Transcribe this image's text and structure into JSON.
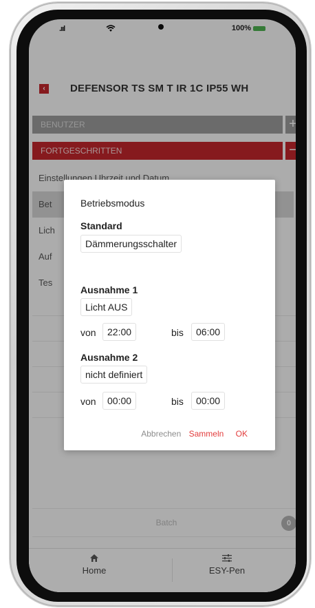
{
  "status_bar": {
    "signal_icon": "signal-icon",
    "wifi_icon": "wifi-icon",
    "battery_text": "100%",
    "battery_color": "#4caf50"
  },
  "header": {
    "back_icon": "back-arrow-icon",
    "title": "DEFENSOR TS SM T IR 1C IP55 WH"
  },
  "sections": {
    "benutzer": {
      "label": "BENUTZER",
      "toggle": "+"
    },
    "fortgeschritten": {
      "label": "FORTGESCHRITTEN",
      "toggle": "−"
    }
  },
  "menu": {
    "items": [
      {
        "label": "Einstellungen Uhrzeit und Datum"
      },
      {
        "label": "Bet"
      },
      {
        "label": "Lich"
      },
      {
        "label": "Auf"
      },
      {
        "label": "Tes"
      }
    ]
  },
  "batch": {
    "label": "Batch",
    "count": "0"
  },
  "tabs": {
    "home": {
      "label": "Home",
      "icon": "home-icon"
    },
    "esypen": {
      "label": "ESY-Pen",
      "icon": "sliders-icon"
    }
  },
  "dialog": {
    "title": "Betriebsmodus",
    "standard_label": "Standard",
    "standard_value": "Dämmerungsschalter",
    "exception1_label": "Ausnahme 1",
    "exception1_value": "Licht AUS",
    "exception1_from_label": "von",
    "exception1_from": "22:00",
    "exception1_to_label": "bis",
    "exception1_to": "06:00",
    "exception2_label": "Ausnahme 2",
    "exception2_value": "nicht definiert",
    "exception2_from_label": "von",
    "exception2_from": "00:00",
    "exception2_to_label": "bis",
    "exception2_to": "00:00",
    "cancel_label": "Abbrechen",
    "save_label": "Sammeln",
    "ok_label": "OK"
  },
  "colors": {
    "accent_red": "#c0262c",
    "section_gray": "#9a9a9a",
    "action_red": "#e23b3b"
  }
}
